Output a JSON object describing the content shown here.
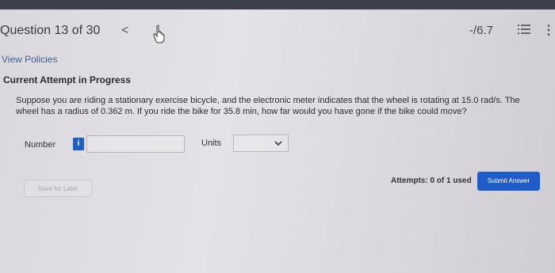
{
  "header": {
    "question_title": "Question 13 of 30",
    "prev_glyph": "<",
    "score": "-/6.7",
    "more_glyph": "⋮"
  },
  "links": {
    "view_policies": "View Policies"
  },
  "attempt": {
    "label": "Current Attempt in Progress"
  },
  "question": {
    "text": "Suppose you are riding a stationary exercise bicycle, and the electronic meter indicates that the wheel is rotating at 15.0 rad/s. The wheel has a radius of 0.362 m. If you ride the bike for 35.8 min, how far would you have gone if the bike could move?"
  },
  "answer": {
    "number_label": "Number",
    "info_badge": "i",
    "number_value": "",
    "units_label": "Units",
    "units_selected": ""
  },
  "footer": {
    "save_later": "Save for Later",
    "attempts": "Attempts: 0 of 1 used",
    "submit": "Submit Answer"
  },
  "colors": {
    "accent": "#1d5cc9",
    "link": "#41618f",
    "top_strip": "#3d3f4c"
  }
}
